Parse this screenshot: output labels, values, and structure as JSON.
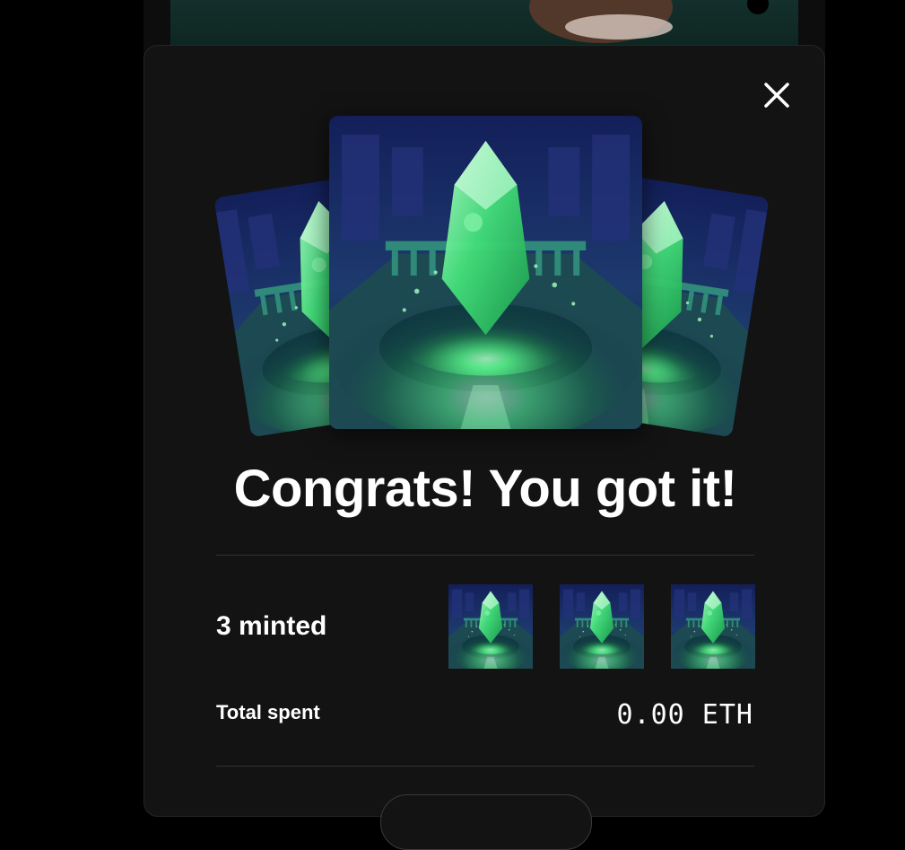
{
  "modal": {
    "title": "Congrats! You got it!",
    "minted_label": "3 minted",
    "total_spent_label": "Total spent",
    "total_spent_value": "0.00 ETH"
  },
  "icons": {
    "close": "close-icon"
  },
  "colors": {
    "modal_bg": "#131313",
    "accent_green": "#3cff7a",
    "card_blue": "#1a2a6a"
  },
  "minted_items": [
    {
      "name": "crystal-nft"
    },
    {
      "name": "crystal-nft"
    },
    {
      "name": "crystal-nft"
    }
  ]
}
